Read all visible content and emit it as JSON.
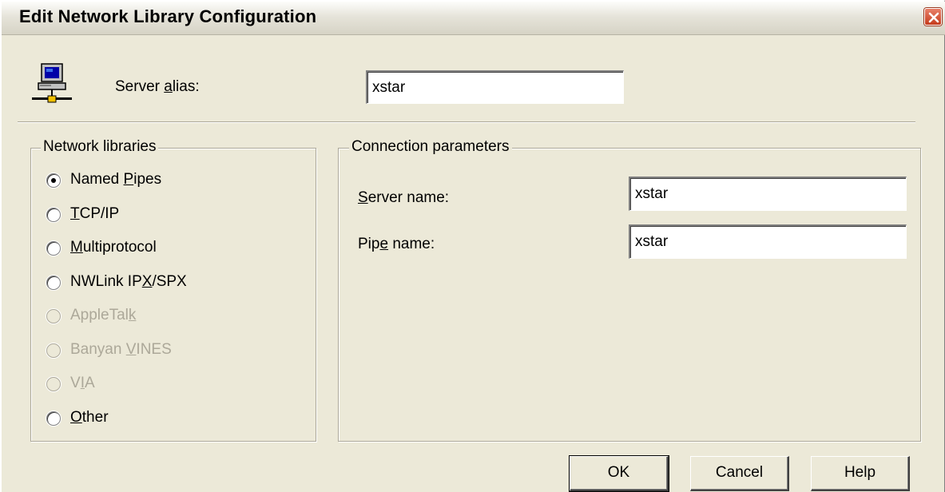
{
  "window": {
    "title": "Edit Network Library Configuration",
    "close_icon": "close-icon"
  },
  "alias": {
    "label_before": "Server ",
    "label_accel": "a",
    "label_after": "lias:",
    "value": "xstar",
    "icon": "server-computer-icon"
  },
  "network_libraries": {
    "legend": "Network libraries",
    "options": [
      {
        "pre": "Named ",
        "accel": "P",
        "post": "ipes",
        "selected": true,
        "enabled": true
      },
      {
        "pre": "",
        "accel": "T",
        "post": "CP/IP",
        "selected": false,
        "enabled": true
      },
      {
        "pre": "",
        "accel": "M",
        "post": "ultiprotocol",
        "selected": false,
        "enabled": true
      },
      {
        "pre": "NWLink IP",
        "accel": "X",
        "post": "/SPX",
        "selected": false,
        "enabled": true
      },
      {
        "pre": "AppleTal",
        "accel": "k",
        "post": "",
        "selected": false,
        "enabled": false
      },
      {
        "pre": "Banyan ",
        "accel": "V",
        "post": "INES",
        "selected": false,
        "enabled": false
      },
      {
        "pre": "V",
        "accel": "I",
        "post": "A",
        "selected": false,
        "enabled": false
      },
      {
        "pre": "",
        "accel": "O",
        "post": "ther",
        "selected": false,
        "enabled": true
      }
    ]
  },
  "connection": {
    "legend": "Connection parameters",
    "server_name": {
      "pre": "",
      "accel": "S",
      "post": "erver name:",
      "value": "xstar"
    },
    "pipe_name": {
      "pre": "Pip",
      "accel": "e",
      "post": " name:",
      "value": "xstar"
    }
  },
  "buttons": {
    "ok": "OK",
    "cancel": "Cancel",
    "help": "Help"
  }
}
